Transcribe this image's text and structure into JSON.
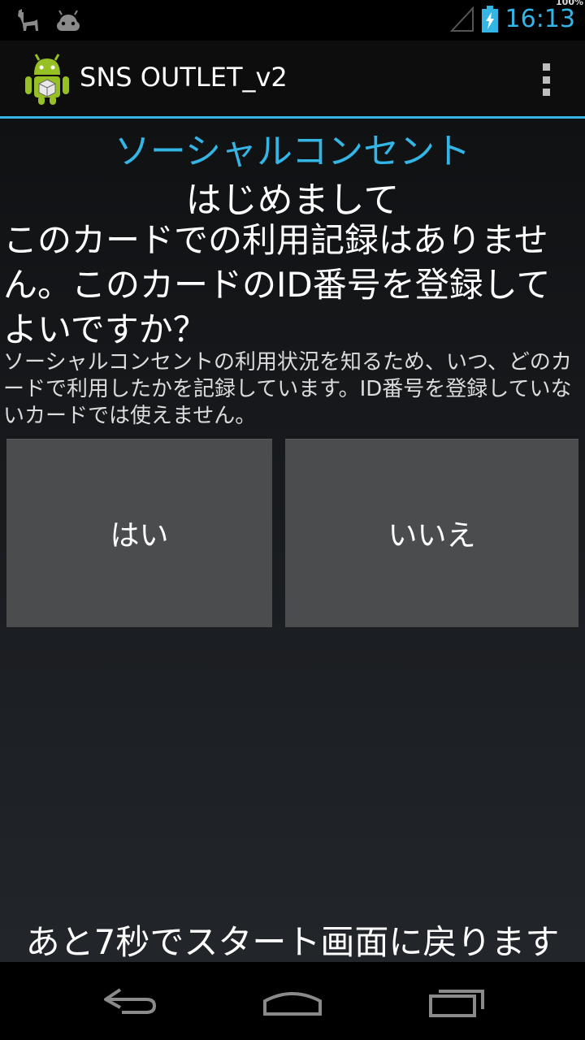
{
  "status_bar": {
    "time": "16:13",
    "battery_percent": "100%",
    "left_icons": [
      "llama-icon",
      "android-head-icon"
    ],
    "accent_color": "#33b5e5"
  },
  "action_bar": {
    "app_title": "SNS OUTLET_v2",
    "app_icon": "android-robot-icon",
    "menu_icon": "overflow-menu-icon"
  },
  "content": {
    "title": "ソーシャルコンセント",
    "greeting": "はじめまして",
    "question": "このカードでの利用記録はありません。このカードのID番号を登録してよいですか？",
    "explanation": "ソーシャルコンセントの利用状況を知るため、いつ、どのカードで利用したかを記録しています。ID番号を登録していないカードでは使えません。",
    "yes_label": "はい",
    "no_label": "いいえ",
    "countdown": "あと7秒でスタート画面に戻ります"
  },
  "nav_bar": {
    "icons": [
      "back-icon",
      "home-icon",
      "recent-apps-icon"
    ]
  }
}
